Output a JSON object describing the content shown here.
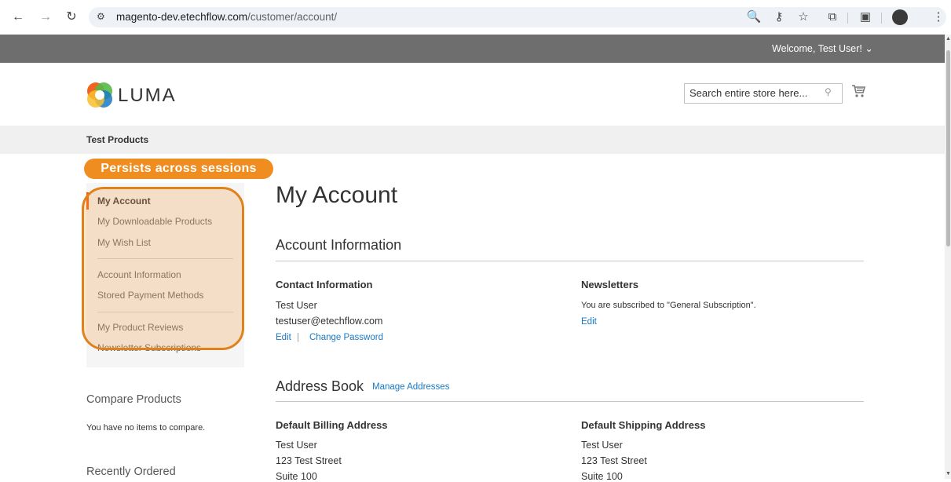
{
  "browser": {
    "url_host": "magento-dev.etechflow.com",
    "url_path": "/customer/account/"
  },
  "header": {
    "welcome": "Welcome, Test User!",
    "logo_text": "LUMA",
    "search_placeholder": "Search entire store here..."
  },
  "nav": {
    "item": "Test Products"
  },
  "annotation": {
    "badge": "Persists across sessions"
  },
  "sidebar": {
    "items": [
      {
        "label": "My Account"
      },
      {
        "label": "My Downloadable Products"
      },
      {
        "label": "My Wish List"
      },
      {
        "label": "Account Information"
      },
      {
        "label": "Stored Payment Methods"
      },
      {
        "label": "My Product Reviews"
      },
      {
        "label": "Newsletter Subscriptions"
      }
    ],
    "compare_title": "Compare Products",
    "compare_text": "You have no items to compare.",
    "recent_title": "Recently Ordered"
  },
  "main": {
    "title": "My Account",
    "account_info": {
      "title": "Account Information",
      "contact_title": "Contact Information",
      "name": "Test User",
      "email": "testuser@etechflow.com",
      "edit": "Edit",
      "sep": "|",
      "change_password": "Change Password",
      "newsletters_title": "Newsletters",
      "newsletters_text": "You are subscribed to \"General Subscription\".",
      "newsletters_edit": "Edit"
    },
    "address_book": {
      "title": "Address Book",
      "manage": "Manage Addresses",
      "billing_title": "Default Billing Address",
      "billing_lines": [
        "Test User",
        "123 Test Street",
        "Suite 100"
      ],
      "shipping_title": "Default Shipping Address",
      "shipping_lines": [
        "Test User",
        "123 Test Street",
        "Suite 100"
      ]
    }
  },
  "colors": {
    "accent": "#ef8d21",
    "link": "#1979c3",
    "topbar": "#6e6e6e"
  }
}
